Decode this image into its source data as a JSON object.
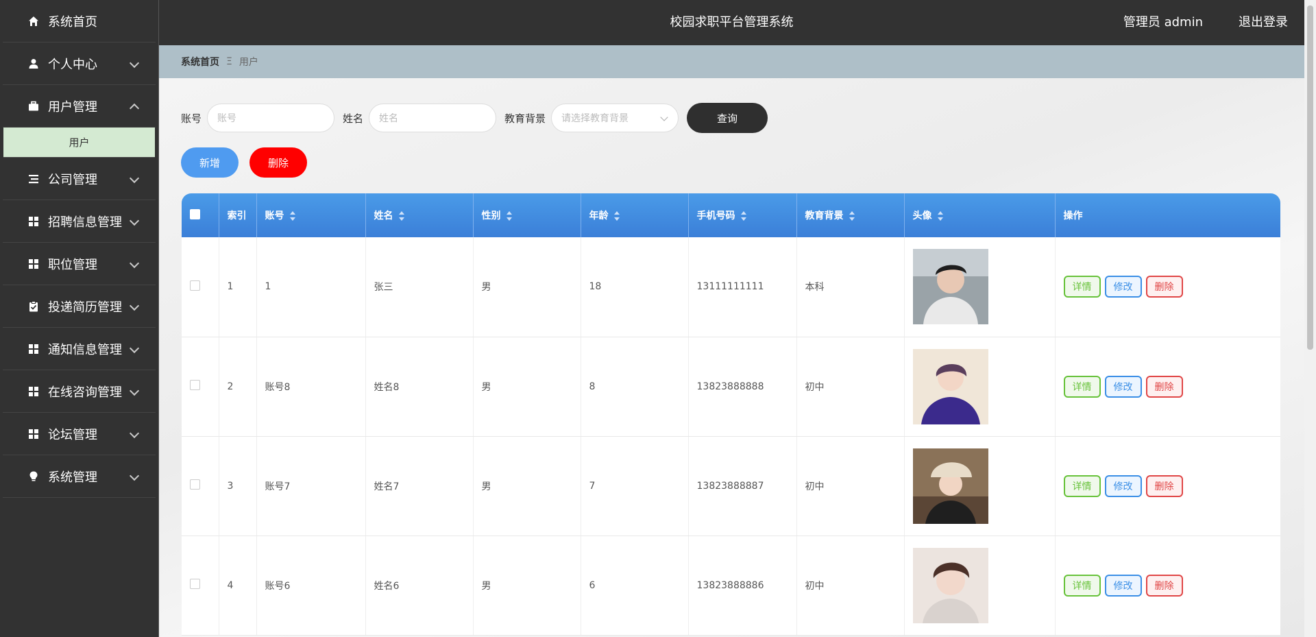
{
  "sidebar": {
    "items": [
      {
        "label": "系统首页",
        "icon": "home-icon",
        "chevron": "none"
      },
      {
        "label": "个人中心",
        "icon": "user-icon",
        "chevron": "down"
      },
      {
        "label": "用户管理",
        "icon": "briefcase-icon",
        "chevron": "up",
        "sub": "用户"
      },
      {
        "label": "公司管理",
        "icon": "list-icon",
        "chevron": "down"
      },
      {
        "label": "招聘信息管理",
        "icon": "grid-icon",
        "chevron": "down"
      },
      {
        "label": "职位管理",
        "icon": "grid-icon",
        "chevron": "down"
      },
      {
        "label": "投递简历管理",
        "icon": "clipboard-check-icon",
        "chevron": "down"
      },
      {
        "label": "通知信息管理",
        "icon": "grid-icon",
        "chevron": "down"
      },
      {
        "label": "在线咨询管理",
        "icon": "grid-icon",
        "chevron": "down"
      },
      {
        "label": "论坛管理",
        "icon": "grid-icon",
        "chevron": "down"
      },
      {
        "label": "系统管理",
        "icon": "lightbulb-icon",
        "chevron": "down"
      }
    ]
  },
  "header": {
    "title": "校园求职平台管理系统",
    "user": "管理员 admin",
    "logout": "退出登录"
  },
  "breadcrumb": {
    "home": "系统首页",
    "separator": "Ξ",
    "current": "用户"
  },
  "search": {
    "account_label": "账号",
    "account_placeholder": "账号",
    "name_label": "姓名",
    "name_placeholder": "姓名",
    "edu_label": "教育背景",
    "edu_placeholder": "请选择教育背景",
    "query": "查询"
  },
  "actions": {
    "add": "新增",
    "delete": "删除"
  },
  "table": {
    "headers": [
      "索引",
      "账号",
      "姓名",
      "性别",
      "年龄",
      "手机号码",
      "教育背景",
      "头像",
      "操作"
    ],
    "ops": {
      "detail": "详情",
      "edit": "修改",
      "delete": "删除"
    },
    "rows": [
      {
        "index": "1",
        "account": "1",
        "name": "张三",
        "gender": "男",
        "age": "18",
        "phone": "13111111111",
        "edu": "本科"
      },
      {
        "index": "2",
        "account": "账号8",
        "name": "姓名8",
        "gender": "男",
        "age": "8",
        "phone": "13823888888",
        "edu": "初中"
      },
      {
        "index": "3",
        "account": "账号7",
        "name": "姓名7",
        "gender": "男",
        "age": "7",
        "phone": "13823888887",
        "edu": "初中"
      },
      {
        "index": "4",
        "account": "账号6",
        "name": "姓名6",
        "gender": "男",
        "age": "6",
        "phone": "13823888886",
        "edu": "初中"
      }
    ]
  },
  "colors": {
    "sidebar_bg": "#323232",
    "header_bg": "#323232",
    "breadcrumb_bg": "#aebfc8",
    "table_header": "#3b7fd8",
    "submenu_active": "#d4ead2"
  }
}
